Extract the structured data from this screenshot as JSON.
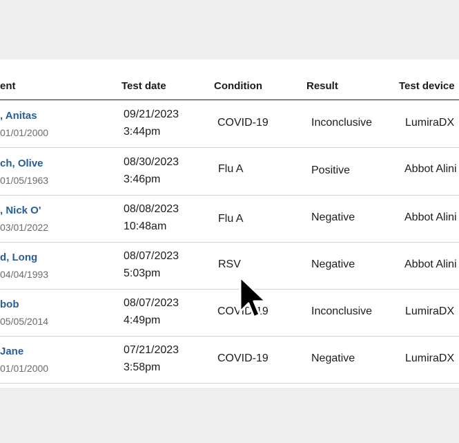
{
  "table": {
    "headers": [
      "ent",
      "Test date",
      "Condition",
      "Result",
      "Test device"
    ],
    "rows": [
      {
        "patient": ", Anitas",
        "dob": "01/01/2000",
        "date": "09/21/2023",
        "time": "3:44pm",
        "condition": "COVID-19",
        "result": "Inconclusive",
        "device": "LumiraDX"
      },
      {
        "patient": "ch, Olive",
        "dob": "01/05/1963",
        "date": "08/30/2023",
        "time": "3:46pm",
        "condition": "Flu A",
        "result": "Positive",
        "device": "Abbot Alini"
      },
      {
        "patient": ", Nick O'",
        "dob": "03/01/2022",
        "date": "08/08/2023",
        "time": "10:48am",
        "condition": "Flu A",
        "result": "Negative",
        "device": "Abbot Alini"
      },
      {
        "patient": "d, Long",
        "dob": "04/04/1993",
        "date": "08/07/2023",
        "time": "5:03pm",
        "condition": "RSV",
        "result": "Negative",
        "device": "Abbot Alini"
      },
      {
        "patient": "bob",
        "dob": "05/05/2014",
        "date": "08/07/2023",
        "time": "4:49pm",
        "condition": "COVID-19",
        "result": "Inconclusive",
        "device": "LumiraDX"
      },
      {
        "patient": "Jane",
        "dob": "01/01/2000",
        "date": "07/21/2023",
        "time": "3:58pm",
        "condition": "COVID-19",
        "result": "Negative",
        "device": "LumiraDX"
      }
    ]
  },
  "icons": {
    "cursor": "mouse-pointer-icon"
  }
}
